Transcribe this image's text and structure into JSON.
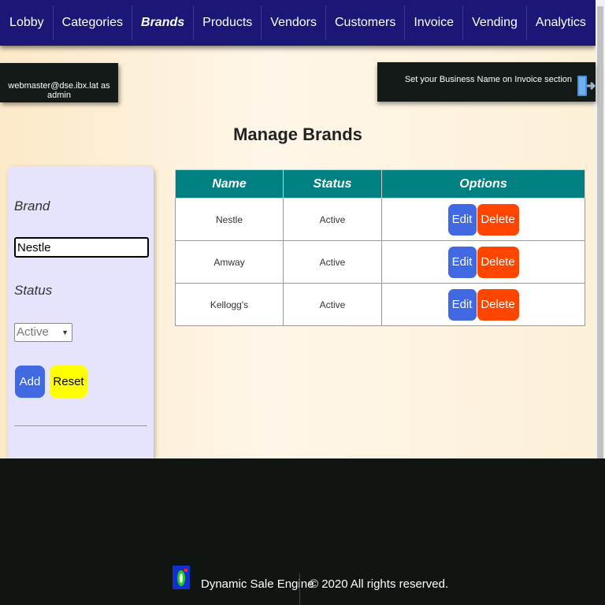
{
  "nav": {
    "items": [
      {
        "label": "Lobby"
      },
      {
        "label": "Categories"
      },
      {
        "label": "Brands"
      },
      {
        "label": "Products"
      },
      {
        "label": "Vendors"
      },
      {
        "label": "Customers"
      },
      {
        "label": "Invoice"
      },
      {
        "label": "Vending"
      },
      {
        "label": "Analytics"
      }
    ],
    "active": "Brands"
  },
  "user": {
    "line1": "webmaster@dse.ibx.lat as",
    "line2": "admin"
  },
  "business_notice": "Set your Business Name on Invoice section",
  "page_title": "Manage Brands",
  "form": {
    "brand_label": "Brand",
    "brand_value": "Nestle",
    "status_label": "Status",
    "status_value": "Active",
    "add_label": "Add",
    "reset_label": "Reset"
  },
  "table": {
    "headers": [
      "Name",
      "Status",
      "Options"
    ],
    "rows": [
      {
        "name": "Nestle",
        "status": "Active"
      },
      {
        "name": "Amway",
        "status": "Active"
      },
      {
        "name": "Kellogg's",
        "status": "Active"
      }
    ],
    "edit_label": "Edit",
    "delete_label": "Delete"
  },
  "footer": {
    "app_name": "Dynamic Sale Engine",
    "copyright": "© 2020 All rights reserved."
  },
  "colors": {
    "nav_bg": "#1a1777",
    "table_header": "#008080",
    "edit_button": "#4169e1",
    "delete_button": "#ff4500",
    "reset_button": "#ffff00",
    "footer_bg": "#111512"
  }
}
